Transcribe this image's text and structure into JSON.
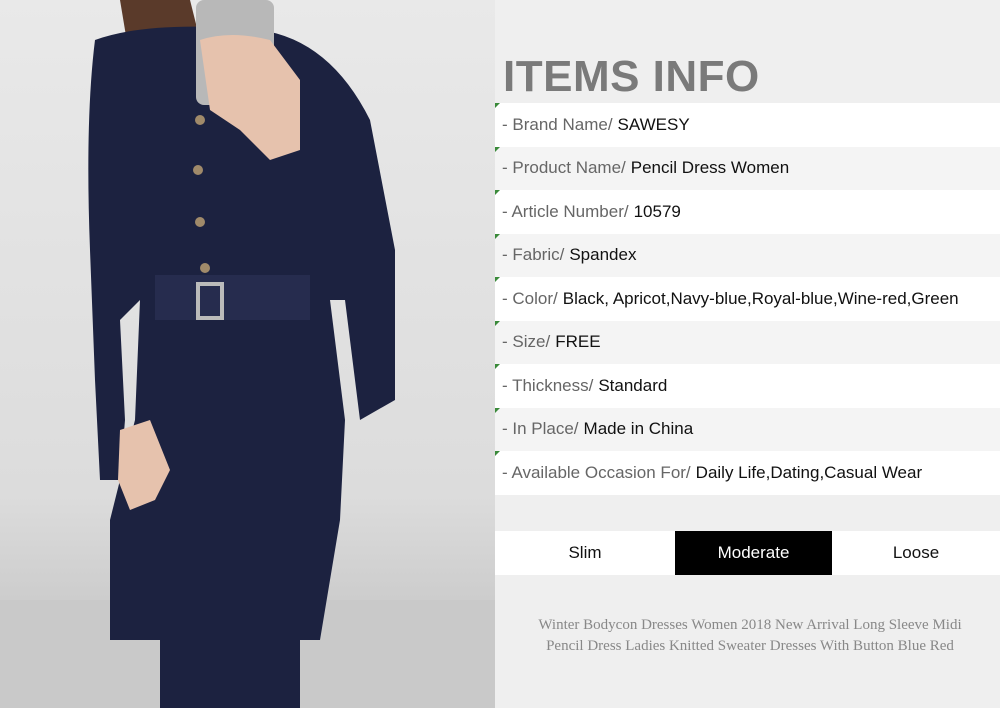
{
  "heading": "ITEMS INFO",
  "info_rows": [
    {
      "label": "- Brand Name/",
      "value": "SAWESY"
    },
    {
      "label": "- Product Name/",
      "value": "Pencil Dress Women"
    },
    {
      "label": "- Article Number/",
      "value": "10579"
    },
    {
      "label": "- Fabric/",
      "value": "Spandex"
    },
    {
      "label": "- Color/",
      "value": "Black, Apricot,Navy-blue,Royal-blue,Wine-red,Green"
    },
    {
      "label": "- Size/",
      "value": "FREE"
    },
    {
      "label": "- Thickness/",
      "value": "Standard"
    },
    {
      "label": "- In Place/",
      "value": "Made in China"
    },
    {
      "label": "- Available Occasion For/",
      "value": "Daily Life,Dating,Casual Wear"
    }
  ],
  "fit_options": [
    {
      "label": "Slim",
      "selected": false
    },
    {
      "label": "Moderate",
      "selected": true
    },
    {
      "label": "Loose",
      "selected": false
    }
  ],
  "description": "Winter Bodycon Dresses Women 2018 New Arrival Long Sleeve Midi Pencil Dress Ladies Knitted Sweater Dresses With Button Blue Red",
  "colors": {
    "dress": "#1c2240",
    "selected_fit_bg": "#000000",
    "tick": "#3a8a3a"
  }
}
